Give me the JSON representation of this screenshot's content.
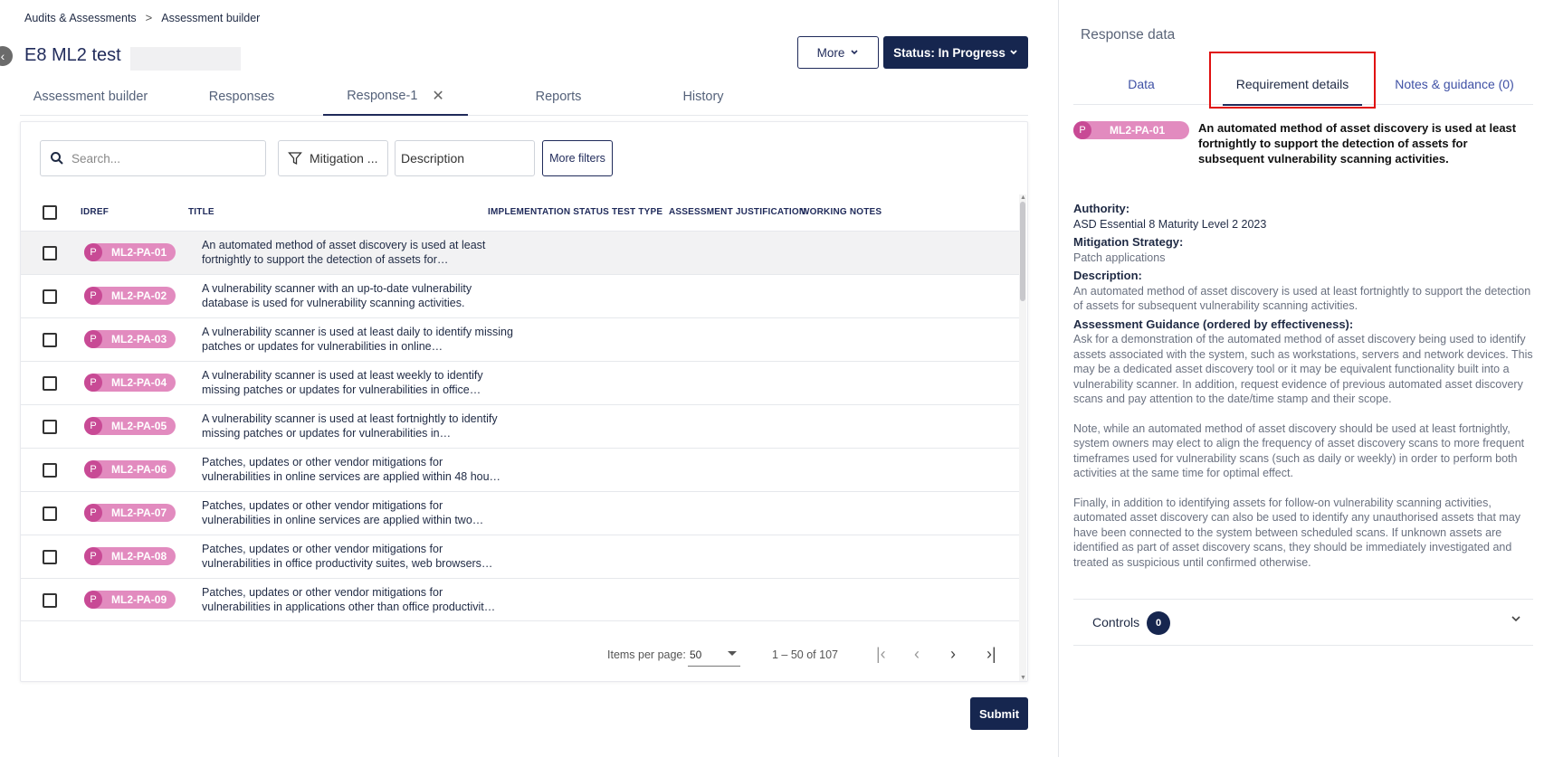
{
  "breadcrumb": {
    "root": "Audits & Assessments",
    "separator": ">",
    "current": "Assessment builder"
  },
  "page": {
    "title": "E8 ML2 test"
  },
  "header_actions": {
    "more_label": "More",
    "status_label": "Status: In Progress"
  },
  "tabs": [
    {
      "label": "Assessment builder"
    },
    {
      "label": "Responses"
    },
    {
      "label": "Response-1"
    },
    {
      "label": "Reports"
    },
    {
      "label": "History"
    }
  ],
  "filters": {
    "search_placeholder": "Search...",
    "mitigation_label": "Mitigation ...",
    "description_label": "Description",
    "more_filters_label": "More filters"
  },
  "table": {
    "columns": [
      "IDREF",
      "TITLE",
      "IMPLEMENTATION STATUS",
      "TEST TYPE",
      "ASSESSMENT JUSTIFICATION",
      "WORKING NOTES"
    ],
    "badge_letter": "P",
    "rows": [
      {
        "id": "ML2-PA-01",
        "title": "An automated method of asset discovery is used at least fortnightly to support the detection of assets for…"
      },
      {
        "id": "ML2-PA-02",
        "title": "A vulnerability scanner with an up-to-date vulnerability database is used for vulnerability scanning activities."
      },
      {
        "id": "ML2-PA-03",
        "title": "A vulnerability scanner is used at least daily to identify missing patches or updates for vulnerabilities in online…"
      },
      {
        "id": "ML2-PA-04",
        "title": "A vulnerability scanner is used at least weekly to identify missing patches or updates for vulnerabilities in office…"
      },
      {
        "id": "ML2-PA-05",
        "title": "A vulnerability scanner is used at least fortnightly to identify missing patches or updates for vulnerabilities in…"
      },
      {
        "id": "ML2-PA-06",
        "title": "Patches, updates or other vendor mitigations for vulnerabilities in online services are applied within 48 hou…"
      },
      {
        "id": "ML2-PA-07",
        "title": "Patches, updates or other vendor mitigations for vulnerabilities in online services are applied within two…"
      },
      {
        "id": "ML2-PA-08",
        "title": "Patches, updates or other vendor mitigations for vulnerabilities in office productivity suites, web browsers…"
      },
      {
        "id": "ML2-PA-09",
        "title": "Patches, updates or other vendor mitigations for vulnerabilities in applications other than office productivit…"
      }
    ]
  },
  "pagination": {
    "items_per_page_label": "Items per page:",
    "items_per_page": "50",
    "range": "1 – 50 of 107"
  },
  "submit_label": "Submit",
  "right_panel": {
    "title": "Response data",
    "tabs": [
      {
        "label": "Data"
      },
      {
        "label": "Requirement details"
      },
      {
        "label": "Notes & guidance (0)"
      }
    ],
    "badge_letter": "P",
    "badge_id": "ML2-PA-01",
    "heading": "An automated method of asset discovery is used at least fortnightly to support the detection of assets for subsequent vulnerability scanning activities.",
    "authority_label": "Authority:",
    "authority": "ASD Essential 8 Maturity Level 2 2023",
    "mitigation_label": "Mitigation Strategy:",
    "mitigation": "Patch applications",
    "description_label": "Description:",
    "description": "An automated method of asset discovery is used at least fortnightly to support the detection of assets for subsequent vulnerability scanning activities.",
    "guidance_label": "Assessment Guidance (ordered by effectiveness):",
    "guidance_1": "Ask for a demonstration of the automated method of asset discovery being used to identify assets associated with the system, such as workstations, servers and network devices. This may be a dedicated asset discovery tool or it may be equivalent functionality built into a vulnerability scanner. In addition, request evidence of previous automated asset discovery scans and pay attention to the date/time stamp and their scope.",
    "guidance_2": "Note, while an automated method of asset discovery should be used at least fortnightly, system owners may elect to align the frequency of asset discovery scans to more frequent timeframes used for vulnerability scans (such as daily or weekly) in order to perform both activities at the same time for optimal effect.",
    "guidance_3": "Finally, in addition to identifying assets for follow-on vulnerability scanning activities, automated asset discovery can also be used to identify any unauthorised assets that may have been connected to the system between scheduled scans. If unknown assets are identified as part of asset discovery scans, they should be immediately investigated and treated as suspicious until confirmed otherwise.",
    "controls_label": "Controls",
    "controls_count": "0"
  },
  "colors": {
    "primary": "#16264f",
    "badge": "#e28bbf",
    "badge_dot": "#c84a95",
    "highlight": "#e01010"
  }
}
